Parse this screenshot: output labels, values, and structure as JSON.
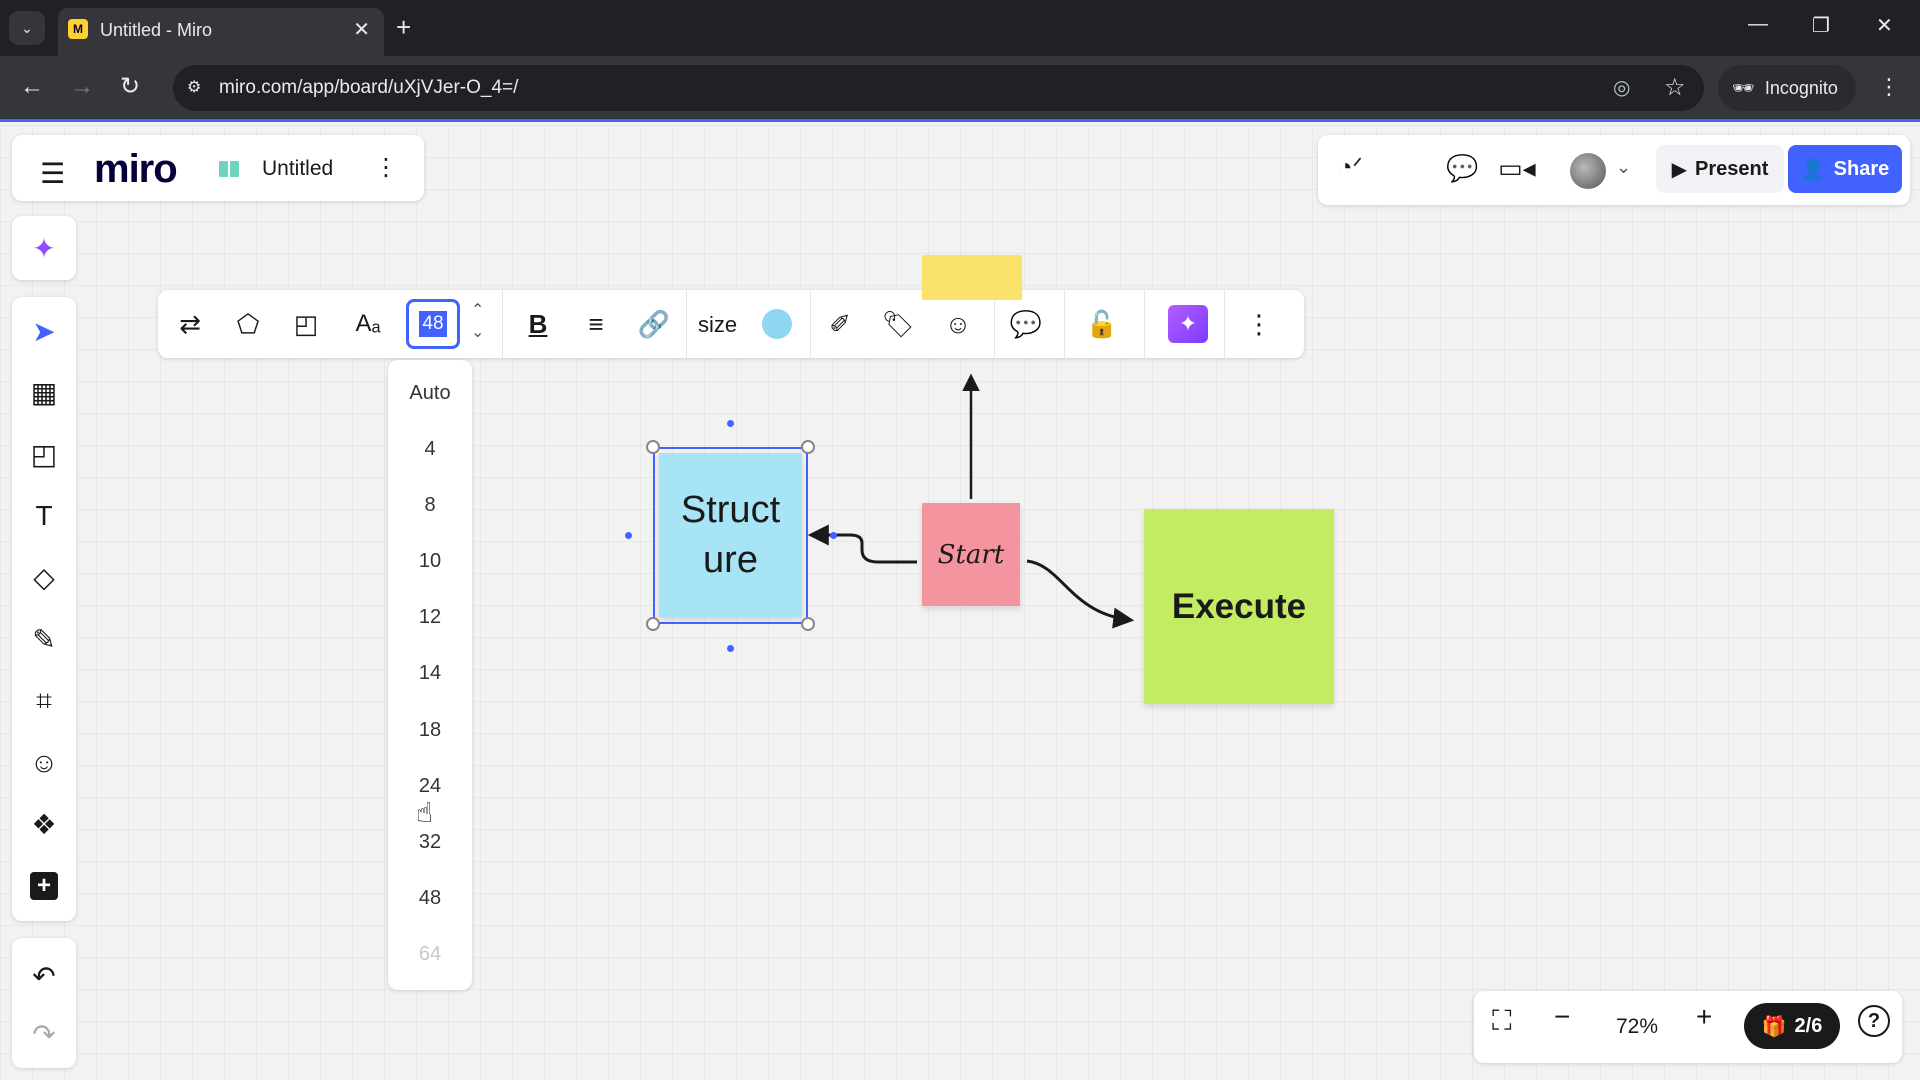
{
  "browser": {
    "tab_title": "Untitled - Miro",
    "favicon_letter": "M",
    "url": "miro.com/app/board/uXjVJer-O_4=/",
    "incognito_label": "Incognito"
  },
  "app": {
    "logo": "miro",
    "board_name": "Untitled",
    "present_label": "Present",
    "share_label": "Share",
    "accent_color": "#4262ff"
  },
  "toolbar": {
    "font_size_value": "48",
    "size_label": "size",
    "fill_color": "#8fd6f2"
  },
  "font_size_options": [
    "Auto",
    "4",
    "8",
    "10",
    "12",
    "14",
    "18",
    "24",
    "32",
    "48",
    "64"
  ],
  "board": {
    "sticky_structure": {
      "text": "Struct\nure",
      "color": "#a7e4f5"
    },
    "sticky_start": {
      "text": "Start",
      "color": "#f4949f"
    },
    "sticky_execute": {
      "text": "Execute",
      "color": "#c3ec63"
    },
    "sticky_top": {
      "text": "",
      "color": "#fbe26a"
    }
  },
  "zoom": {
    "value": "72%",
    "pages": "2/6"
  }
}
